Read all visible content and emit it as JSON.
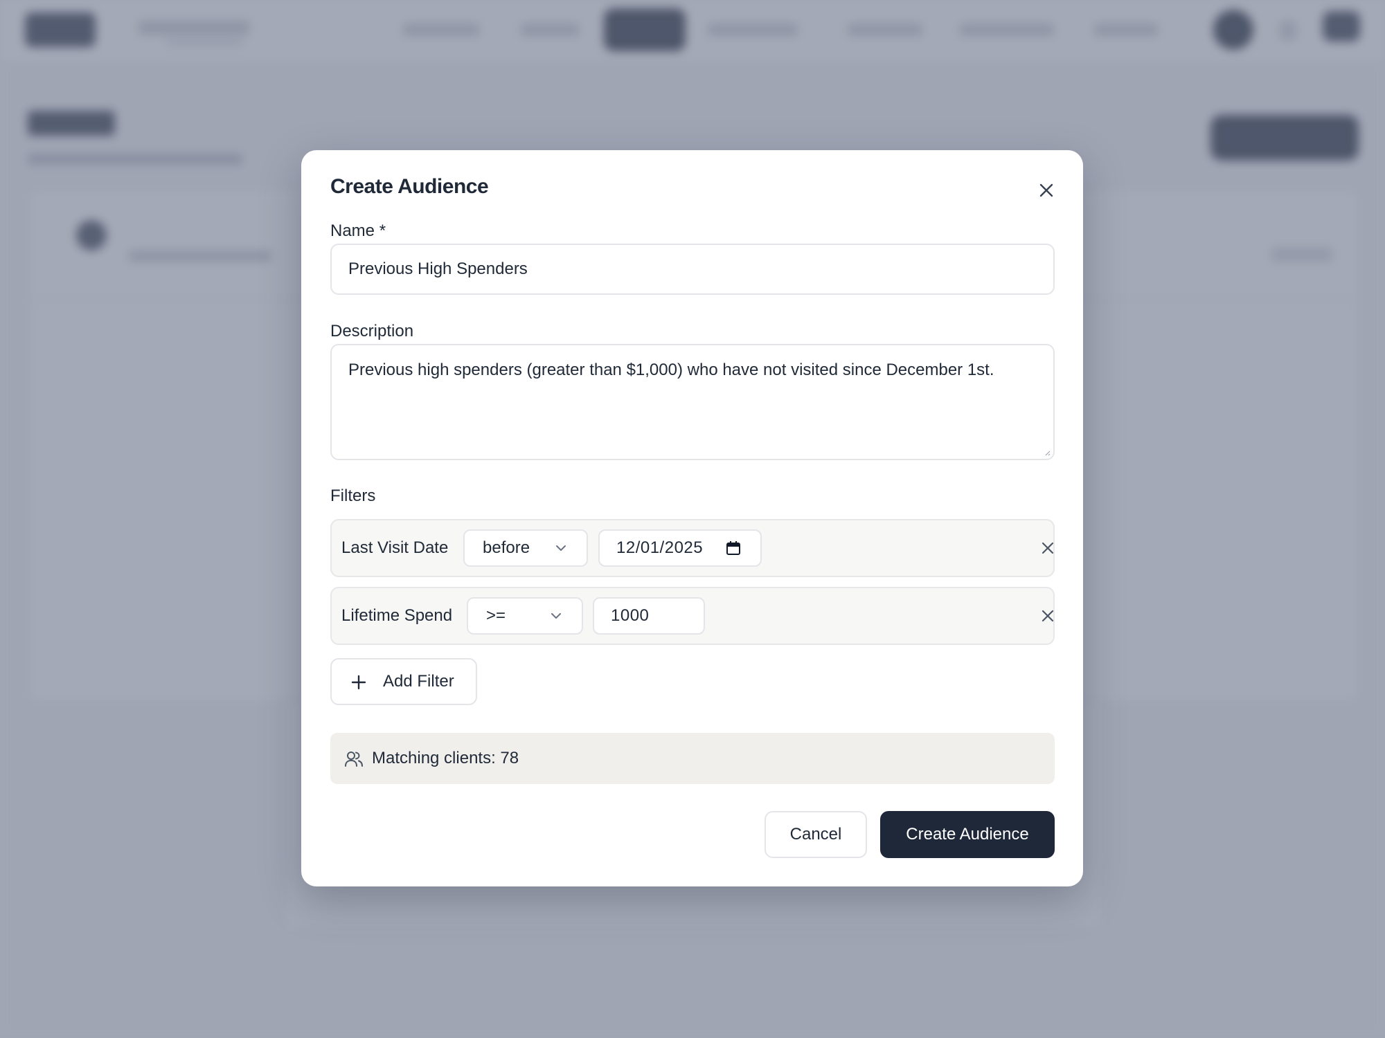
{
  "modal": {
    "title": "Create Audience",
    "name_label": "Name *",
    "name_value": "Previous High Spenders",
    "description_label": "Description",
    "description_value": "Previous high spenders (greater than $1,000) who have not visited since December 1st.",
    "filters_label": "Filters",
    "filters": [
      {
        "field": "Last Visit Date",
        "operator": "before",
        "value": "12/01/2025"
      },
      {
        "field": "Lifetime Spend",
        "operator": ">=",
        "value": "1000"
      }
    ],
    "add_filter_label": "Add Filter",
    "matching_text": "Matching clients: 78",
    "cancel_label": "Cancel",
    "create_label": "Create Audience"
  },
  "icons": {
    "close": "close-icon",
    "chevron": "chevron-down-icon",
    "calendar": "calendar-icon",
    "remove": "remove-filter-icon",
    "add": "plus-icon",
    "users": "users-icon"
  },
  "colors": {
    "primary": "#1e2839",
    "overlay": "#6c758a",
    "filter_row_bg": "#f7f7f6",
    "match_bg": "#f0efec"
  }
}
